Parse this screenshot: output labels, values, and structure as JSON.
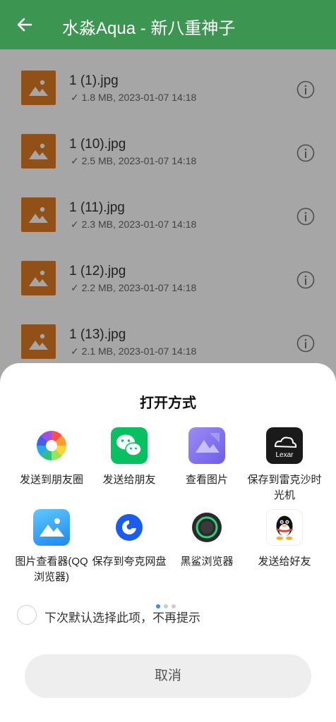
{
  "app_bar": {
    "title": "水淼Aqua - 新八重神子",
    "back_icon": "arrow-back-icon",
    "color": "#3d9552"
  },
  "files": [
    {
      "name": "1 (1).jpg",
      "meta": "1.8 MB, 2023-01-07 14:18"
    },
    {
      "name": "1 (10).jpg",
      "meta": "2.5 MB, 2023-01-07 14:18"
    },
    {
      "name": "1 (11).jpg",
      "meta": "2.3 MB, 2023-01-07 14:18"
    },
    {
      "name": "1 (12).jpg",
      "meta": "2.2 MB, 2023-01-07 14:18"
    },
    {
      "name": "1 (13).jpg",
      "meta": "2.1 MB, 2023-01-07 14:18"
    }
  ],
  "file_icon_color": "#e07b27",
  "sheet": {
    "title": "打开方式",
    "apps": [
      {
        "label": "发送到朋友圈",
        "icon": "moments-icon"
      },
      {
        "label": "发送给朋友",
        "icon": "wechat-icon"
      },
      {
        "label": "查看图片",
        "icon": "gallery-icon"
      },
      {
        "label": "保存到雷克沙时光机",
        "icon": "lexar-icon",
        "icon_text": "Lexar"
      },
      {
        "label": "图片查看器(QQ浏览器)",
        "icon": "image-viewer-icon"
      },
      {
        "label": "保存到夸克网盘",
        "icon": "quark-icon"
      },
      {
        "label": "黑鲨浏览器",
        "icon": "blackshark-browser-icon"
      },
      {
        "label": "发送给好友",
        "icon": "qq-icon"
      }
    ],
    "page_count": 3,
    "current_page": 1,
    "default_option": "下次默认选择此项，不再提示",
    "cancel": "取消"
  }
}
